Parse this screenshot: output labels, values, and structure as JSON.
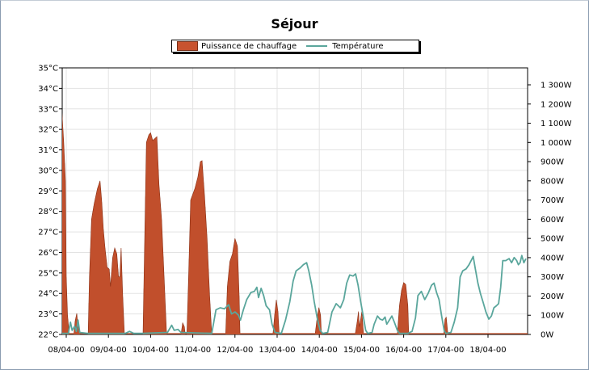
{
  "window": {
    "title": "Séjour"
  },
  "chart_data": {
    "type": "area",
    "title": "Séjour",
    "legend": [
      {
        "name": "Puissance de chauffage",
        "color": "#c8532f",
        "kind": "area"
      },
      {
        "name": "Température",
        "color": "#5aa69c",
        "kind": "line"
      }
    ],
    "legend_position": "top-center",
    "x_ticks": [
      "08/04-00",
      "09/04-00",
      "10/04-00",
      "11/04-00",
      "12/04-00",
      "13/04-00",
      "14/04-00",
      "15/04-00",
      "16/04-00",
      "17/04-00",
      "18/04-00"
    ],
    "xlim": [
      -0.5,
      11.0
    ],
    "y_left": {
      "range": [
        22,
        35
      ],
      "ticks": [
        "22°C",
        "23°C",
        "24°C",
        "25°C",
        "26°C",
        "27°C",
        "28°C",
        "29°C",
        "30°C",
        "31°C",
        "32°C",
        "33°C",
        "34°C",
        "35°C"
      ]
    },
    "y_right": {
      "range": [
        0,
        1400
      ],
      "ticks": [
        "0W",
        "100W",
        "200W",
        "300W",
        "400W",
        "500W",
        "600W",
        "700W",
        "800W",
        "900W",
        "1 000W",
        "1 100W",
        "1 200W",
        "1 300W"
      ]
    },
    "grid": true,
    "series": [
      {
        "name": "Puissance de chauffage",
        "axis": "right",
        "bursts": [
          {
            "start": -0.5,
            "end": 0.07,
            "peak": 0.0,
            "points": [
              [
                -0.5,
                300
              ],
              [
                -0.44,
                700
              ],
              [
                -0.37,
                1020
              ],
              [
                -0.28,
                1100
              ],
              [
                -0.18,
                1150
              ],
              [
                -0.12,
                1190
              ],
              [
                -0.1,
                1150
              ],
              [
                -0.06,
                1000
              ],
              [
                -0.04,
                900
              ],
              [
                -0.02,
                800
              ],
              [
                0.0,
                300
              ],
              [
                0.03,
                100
              ],
              [
                0.07,
                0
              ]
            ]
          },
          {
            "start": 0.18,
            "end": 0.32,
            "points": [
              [
                0.18,
                0
              ],
              [
                0.21,
                70
              ],
              [
                0.25,
                110
              ],
              [
                0.28,
                40
              ],
              [
                0.32,
                0
              ]
            ]
          },
          {
            "start": 0.52,
            "end": 1.38,
            "points": [
              [
                0.52,
                0
              ],
              [
                0.55,
                300
              ],
              [
                0.6,
                600
              ],
              [
                0.66,
                680
              ],
              [
                0.74,
                760
              ],
              [
                0.8,
                800
              ],
              [
                0.84,
                700
              ],
              [
                0.88,
                550
              ],
              [
                0.92,
                450
              ],
              [
                0.97,
                350
              ],
              [
                1.02,
                340
              ],
              [
                1.05,
                250
              ],
              [
                1.1,
                400
              ],
              [
                1.15,
                450
              ],
              [
                1.2,
                420
              ],
              [
                1.24,
                300
              ],
              [
                1.27,
                300
              ],
              [
                1.3,
                450
              ],
              [
                1.34,
                200
              ],
              [
                1.38,
                0
              ]
            ]
          },
          {
            "start": 1.82,
            "end": 2.38,
            "points": [
              [
                1.82,
                0
              ],
              [
                1.86,
                500
              ],
              [
                1.9,
                1000
              ],
              [
                1.96,
                1040
              ],
              [
                2.0,
                1050
              ],
              [
                2.05,
                1010
              ],
              [
                2.1,
                1020
              ],
              [
                2.15,
                1030
              ],
              [
                2.2,
                780
              ],
              [
                2.26,
                600
              ],
              [
                2.32,
                300
              ],
              [
                2.38,
                0
              ]
            ]
          },
          {
            "start": 2.72,
            "end": 2.82,
            "points": [
              [
                2.72,
                0
              ],
              [
                2.76,
                60
              ],
              [
                2.8,
                40
              ],
              [
                2.82,
                0
              ]
            ]
          },
          {
            "start": 2.86,
            "end": 3.45,
            "points": [
              [
                2.86,
                0
              ],
              [
                2.9,
                300
              ],
              [
                2.95,
                700
              ],
              [
                3.05,
                760
              ],
              [
                3.12,
                820
              ],
              [
                3.18,
                900
              ],
              [
                3.22,
                905
              ],
              [
                3.28,
                720
              ],
              [
                3.34,
                500
              ],
              [
                3.4,
                200
              ],
              [
                3.45,
                0
              ]
            ]
          },
          {
            "start": 3.78,
            "end": 4.12,
            "points": [
              [
                3.78,
                0
              ],
              [
                3.82,
                250
              ],
              [
                3.88,
                380
              ],
              [
                3.94,
                420
              ],
              [
                4.0,
                500
              ],
              [
                4.06,
                460
              ],
              [
                4.1,
                200
              ],
              [
                4.12,
                0
              ]
            ]
          },
          {
            "start": 4.9,
            "end": 5.05,
            "points": [
              [
                4.9,
                0
              ],
              [
                4.94,
                100
              ],
              [
                4.98,
                180
              ],
              [
                5.02,
                120
              ],
              [
                5.05,
                0
              ]
            ]
          },
          {
            "start": 5.9,
            "end": 6.05,
            "points": [
              [
                5.9,
                0
              ],
              [
                5.95,
                90
              ],
              [
                5.99,
                140
              ],
              [
                6.03,
                100
              ],
              [
                6.05,
                0
              ]
            ]
          },
          {
            "start": 6.85,
            "end": 7.05,
            "points": [
              [
                6.85,
                0
              ],
              [
                6.9,
                70
              ],
              [
                6.93,
                120
              ],
              [
                6.95,
                40
              ],
              [
                6.98,
                80
              ],
              [
                7.01,
                120
              ],
              [
                7.05,
                0
              ]
            ]
          },
          {
            "start": 7.85,
            "end": 8.12,
            "points": [
              [
                7.85,
                0
              ],
              [
                7.9,
                150
              ],
              [
                7.95,
                230
              ],
              [
                8.0,
                270
              ],
              [
                8.05,
                260
              ],
              [
                8.1,
                150
              ],
              [
                8.12,
                0
              ]
            ]
          },
          {
            "start": 8.95,
            "end": 9.05,
            "points": [
              [
                8.95,
                0
              ],
              [
                8.98,
                80
              ],
              [
                9.01,
                90
              ],
              [
                9.05,
                0
              ]
            ]
          }
        ]
      },
      {
        "name": "Température",
        "axis": "left",
        "points": [
          [
            -0.5,
            22.05
          ],
          [
            0.05,
            22.05
          ],
          [
            0.1,
            22.6
          ],
          [
            0.14,
            22.2
          ],
          [
            0.2,
            22.4
          ],
          [
            0.24,
            22.15
          ],
          [
            0.28,
            22.7
          ],
          [
            0.32,
            22.1
          ],
          [
            0.5,
            22.05
          ],
          [
            1.4,
            22.05
          ],
          [
            1.5,
            22.15
          ],
          [
            1.6,
            22.05
          ],
          [
            1.8,
            22.05
          ],
          [
            2.4,
            22.1
          ],
          [
            2.5,
            22.45
          ],
          [
            2.56,
            22.2
          ],
          [
            2.65,
            22.25
          ],
          [
            2.72,
            22.1
          ],
          [
            3.45,
            22.05
          ],
          [
            3.55,
            23.2
          ],
          [
            3.65,
            23.3
          ],
          [
            3.75,
            23.25
          ],
          [
            3.85,
            23.45
          ],
          [
            3.92,
            23.0
          ],
          [
            4.0,
            23.1
          ],
          [
            4.08,
            22.95
          ],
          [
            4.13,
            22.7
          ],
          [
            4.2,
            23.2
          ],
          [
            4.28,
            23.7
          ],
          [
            4.38,
            24.05
          ],
          [
            4.46,
            24.1
          ],
          [
            4.52,
            24.3
          ],
          [
            4.56,
            23.8
          ],
          [
            4.62,
            24.25
          ],
          [
            4.68,
            23.9
          ],
          [
            4.74,
            23.4
          ],
          [
            4.82,
            23.2
          ],
          [
            4.88,
            22.5
          ],
          [
            4.95,
            22.1
          ],
          [
            5.1,
            22.05
          ],
          [
            5.2,
            22.7
          ],
          [
            5.3,
            23.6
          ],
          [
            5.38,
            24.6
          ],
          [
            5.45,
            25.1
          ],
          [
            5.55,
            25.25
          ],
          [
            5.62,
            25.4
          ],
          [
            5.7,
            25.5
          ],
          [
            5.75,
            25.1
          ],
          [
            5.82,
            24.4
          ],
          [
            5.88,
            23.6
          ],
          [
            5.95,
            22.8
          ],
          [
            6.02,
            22.2
          ],
          [
            6.08,
            22.05
          ],
          [
            6.2,
            22.1
          ],
          [
            6.3,
            23.1
          ],
          [
            6.4,
            23.5
          ],
          [
            6.5,
            23.3
          ],
          [
            6.58,
            23.7
          ],
          [
            6.65,
            24.5
          ],
          [
            6.72,
            24.9
          ],
          [
            6.8,
            24.85
          ],
          [
            6.86,
            24.95
          ],
          [
            6.92,
            24.4
          ],
          [
            6.98,
            23.6
          ],
          [
            7.05,
            22.8
          ],
          [
            7.1,
            22.2
          ],
          [
            7.15,
            22.05
          ],
          [
            7.25,
            22.1
          ],
          [
            7.3,
            22.5
          ],
          [
            7.38,
            22.9
          ],
          [
            7.44,
            22.75
          ],
          [
            7.5,
            22.7
          ],
          [
            7.56,
            22.85
          ],
          [
            7.6,
            22.5
          ],
          [
            7.66,
            22.7
          ],
          [
            7.72,
            22.9
          ],
          [
            7.78,
            22.6
          ],
          [
            7.85,
            22.2
          ],
          [
            7.9,
            22.05
          ],
          [
            8.1,
            22.05
          ],
          [
            8.2,
            22.15
          ],
          [
            8.28,
            22.8
          ],
          [
            8.34,
            23.9
          ],
          [
            8.42,
            24.1
          ],
          [
            8.5,
            23.7
          ],
          [
            8.58,
            24.0
          ],
          [
            8.66,
            24.4
          ],
          [
            8.72,
            24.5
          ],
          [
            8.78,
            24.05
          ],
          [
            8.84,
            23.7
          ],
          [
            8.9,
            22.9
          ],
          [
            8.96,
            22.2
          ],
          [
            9.0,
            22.05
          ],
          [
            9.12,
            22.1
          ],
          [
            9.2,
            22.6
          ],
          [
            9.28,
            23.3
          ],
          [
            9.34,
            24.8
          ],
          [
            9.4,
            25.1
          ],
          [
            9.48,
            25.2
          ],
          [
            9.55,
            25.4
          ],
          [
            9.6,
            25.6
          ],
          [
            9.65,
            25.8
          ],
          [
            9.7,
            25.2
          ],
          [
            9.76,
            24.5
          ],
          [
            9.82,
            24.0
          ],
          [
            9.88,
            23.6
          ],
          [
            9.95,
            23.1
          ],
          [
            10.02,
            22.75
          ],
          [
            10.08,
            22.9
          ],
          [
            10.14,
            23.3
          ],
          [
            10.2,
            23.4
          ],
          [
            10.25,
            23.5
          ],
          [
            10.3,
            24.3
          ],
          [
            10.35,
            25.6
          ],
          [
            10.42,
            25.6
          ],
          [
            10.5,
            25.7
          ],
          [
            10.56,
            25.5
          ],
          [
            10.62,
            25.75
          ],
          [
            10.68,
            25.6
          ],
          [
            10.72,
            25.4
          ],
          [
            10.76,
            25.5
          ],
          [
            10.8,
            25.85
          ],
          [
            10.85,
            25.5
          ],
          [
            10.9,
            25.7
          ]
        ]
      }
    ]
  }
}
